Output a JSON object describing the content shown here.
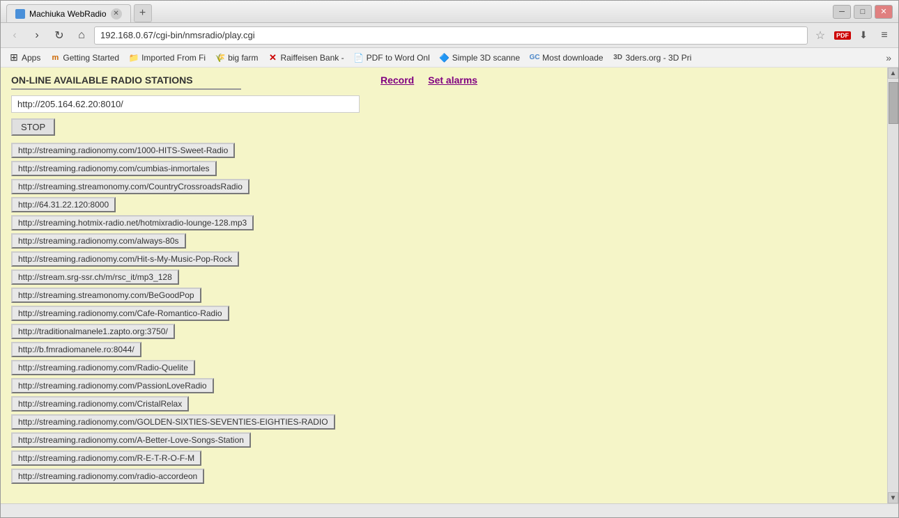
{
  "window": {
    "title": "Machiuka WebRadio",
    "controls": {
      "minimize": "─",
      "restore": "□",
      "close": "✕"
    }
  },
  "tab": {
    "label": "Machiuka WebRadio",
    "close": "✕"
  },
  "nav": {
    "back": "‹",
    "forward": "›",
    "refresh": "↻",
    "home": "⌂",
    "url": "192.168.0.67/cgi-bin/nmsradio/play.cgi",
    "star": "☆"
  },
  "bookmarks": [
    {
      "id": "apps",
      "icon": "⊞",
      "label": "Apps"
    },
    {
      "id": "getting-started",
      "icon": "m",
      "label": "Getting Started"
    },
    {
      "id": "imported-from-fi",
      "icon": "📁",
      "label": "Imported From Fi"
    },
    {
      "id": "big-farm",
      "icon": "🌾",
      "label": "big farm"
    },
    {
      "id": "raiffeisen-bank",
      "icon": "✕",
      "label": "Raiffeisen Bank -"
    },
    {
      "id": "pdf-to-word",
      "icon": "📄",
      "label": "PDF to Word Onl"
    },
    {
      "id": "simple-3d",
      "icon": "🔷",
      "label": "Simple 3D scanne"
    },
    {
      "id": "most-downloaded",
      "icon": "GC",
      "label": "Most downloade"
    },
    {
      "id": "3ders",
      "icon": "3D",
      "label": "3ders.org - 3D Pri"
    }
  ],
  "page": {
    "section_title": "ON-LINE AVAILABLE RADIO STATIONS",
    "record_label": "Record",
    "set_alarms_label": "Set alarms",
    "current_url": "http://205.164.62.20:8010/",
    "stop_label": "STOP",
    "stations": [
      "http://streaming.radionomy.com/1000-HITS-Sweet-Radio",
      "http://streaming.radionomy.com/cumbias-inmortales",
      "http://streaming.streamonomy.com/CountryCrossroadsRadio",
      "http://64.31.22.120:8000",
      "http://streaming.hotmix-radio.net/hotmixradio-lounge-128.mp3",
      "http://streaming.radionomy.com/always-80s",
      "http://streaming.radionomy.com/Hit-s-My-Music-Pop-Rock",
      "http://stream.srg-ssr.ch/m/rsc_it/mp3_128",
      "http://streaming.streamonomy.com/BeGoodPop",
      "http://streaming.radionomy.com/Cafe-Romantico-Radio",
      "http://traditionalmanele1.zapto.org:3750/",
      "http://b.fmradiomanele.ro:8044/",
      "http://streaming.radionomy.com/Radio-Quelite",
      "http://streaming.radionomy.com/PassionLoveRadio",
      "http://streaming.radionomy.com/CristalRelax",
      "http://streaming.radionomy.com/GOLDEN-SIXTIES-SEVENTIES-EIGHTIES-RADIO",
      "http://streaming.radionomy.com/A-Better-Love-Songs-Station",
      "http://streaming.radionomy.com/R-E-T-R-O-F-M",
      "http://streaming.radionomy.com/radio-accordeon"
    ]
  }
}
